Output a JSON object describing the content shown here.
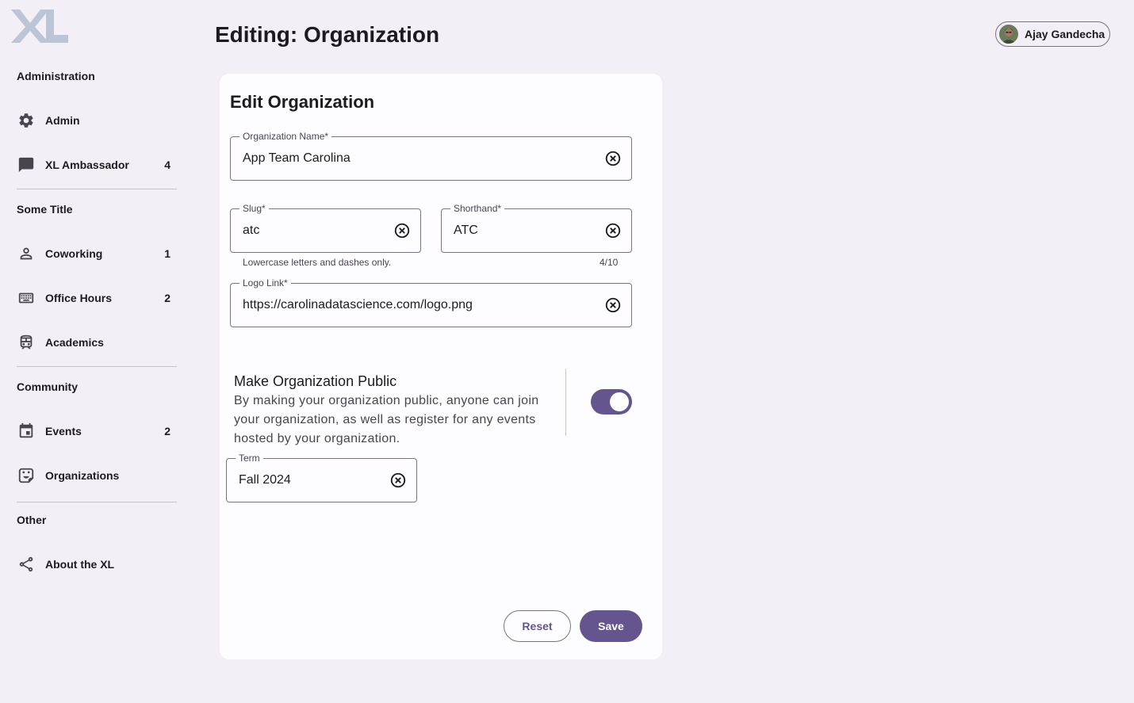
{
  "brand": {
    "logo_text": "XL",
    "accent": "#65558f"
  },
  "header": {
    "title": "Editing: Organization"
  },
  "user": {
    "name": "Ajay Gandecha"
  },
  "sidebar": {
    "sections": [
      {
        "title": "Administration"
      },
      {
        "title": "Some Title"
      },
      {
        "title": "Community"
      },
      {
        "title": "Other"
      }
    ],
    "items": [
      {
        "label": "Admin",
        "icon": "gear-icon",
        "count": ""
      },
      {
        "label": "XL Ambassador",
        "icon": "chat-icon",
        "count": "4"
      },
      {
        "label": "Coworking",
        "icon": "person-icon",
        "count": "1"
      },
      {
        "label": "Office Hours",
        "icon": "keyboard-icon",
        "count": "2"
      },
      {
        "label": "Academics",
        "icon": "bus-icon",
        "count": ""
      },
      {
        "label": "Events",
        "icon": "calendar-icon",
        "count": "2"
      },
      {
        "label": "Organizations",
        "icon": "sticker-icon",
        "count": ""
      },
      {
        "label": "About the XL",
        "icon": "share-icon",
        "count": ""
      }
    ]
  },
  "form": {
    "title": "Edit Organization",
    "org_name": {
      "label": "Organization Name*",
      "value": "App Team Carolina"
    },
    "slug": {
      "label": "Slug*",
      "value": "atc",
      "helper": "Lowercase letters and dashes only."
    },
    "shorthand": {
      "label": "Shorthand*",
      "value": "ATC",
      "counter": "4/10"
    },
    "logo": {
      "label": "Logo Link*",
      "value": "https://carolinadatascience.com/logo.png"
    },
    "public": {
      "title": "Make Organization Public",
      "description": "By making your organization public, anyone can join your organization, as well as register for any events hosted by your organization.",
      "enabled": true
    },
    "term": {
      "label": "Term",
      "value": "Fall 2024"
    },
    "reset_label": "Reset",
    "save_label": "Save"
  }
}
